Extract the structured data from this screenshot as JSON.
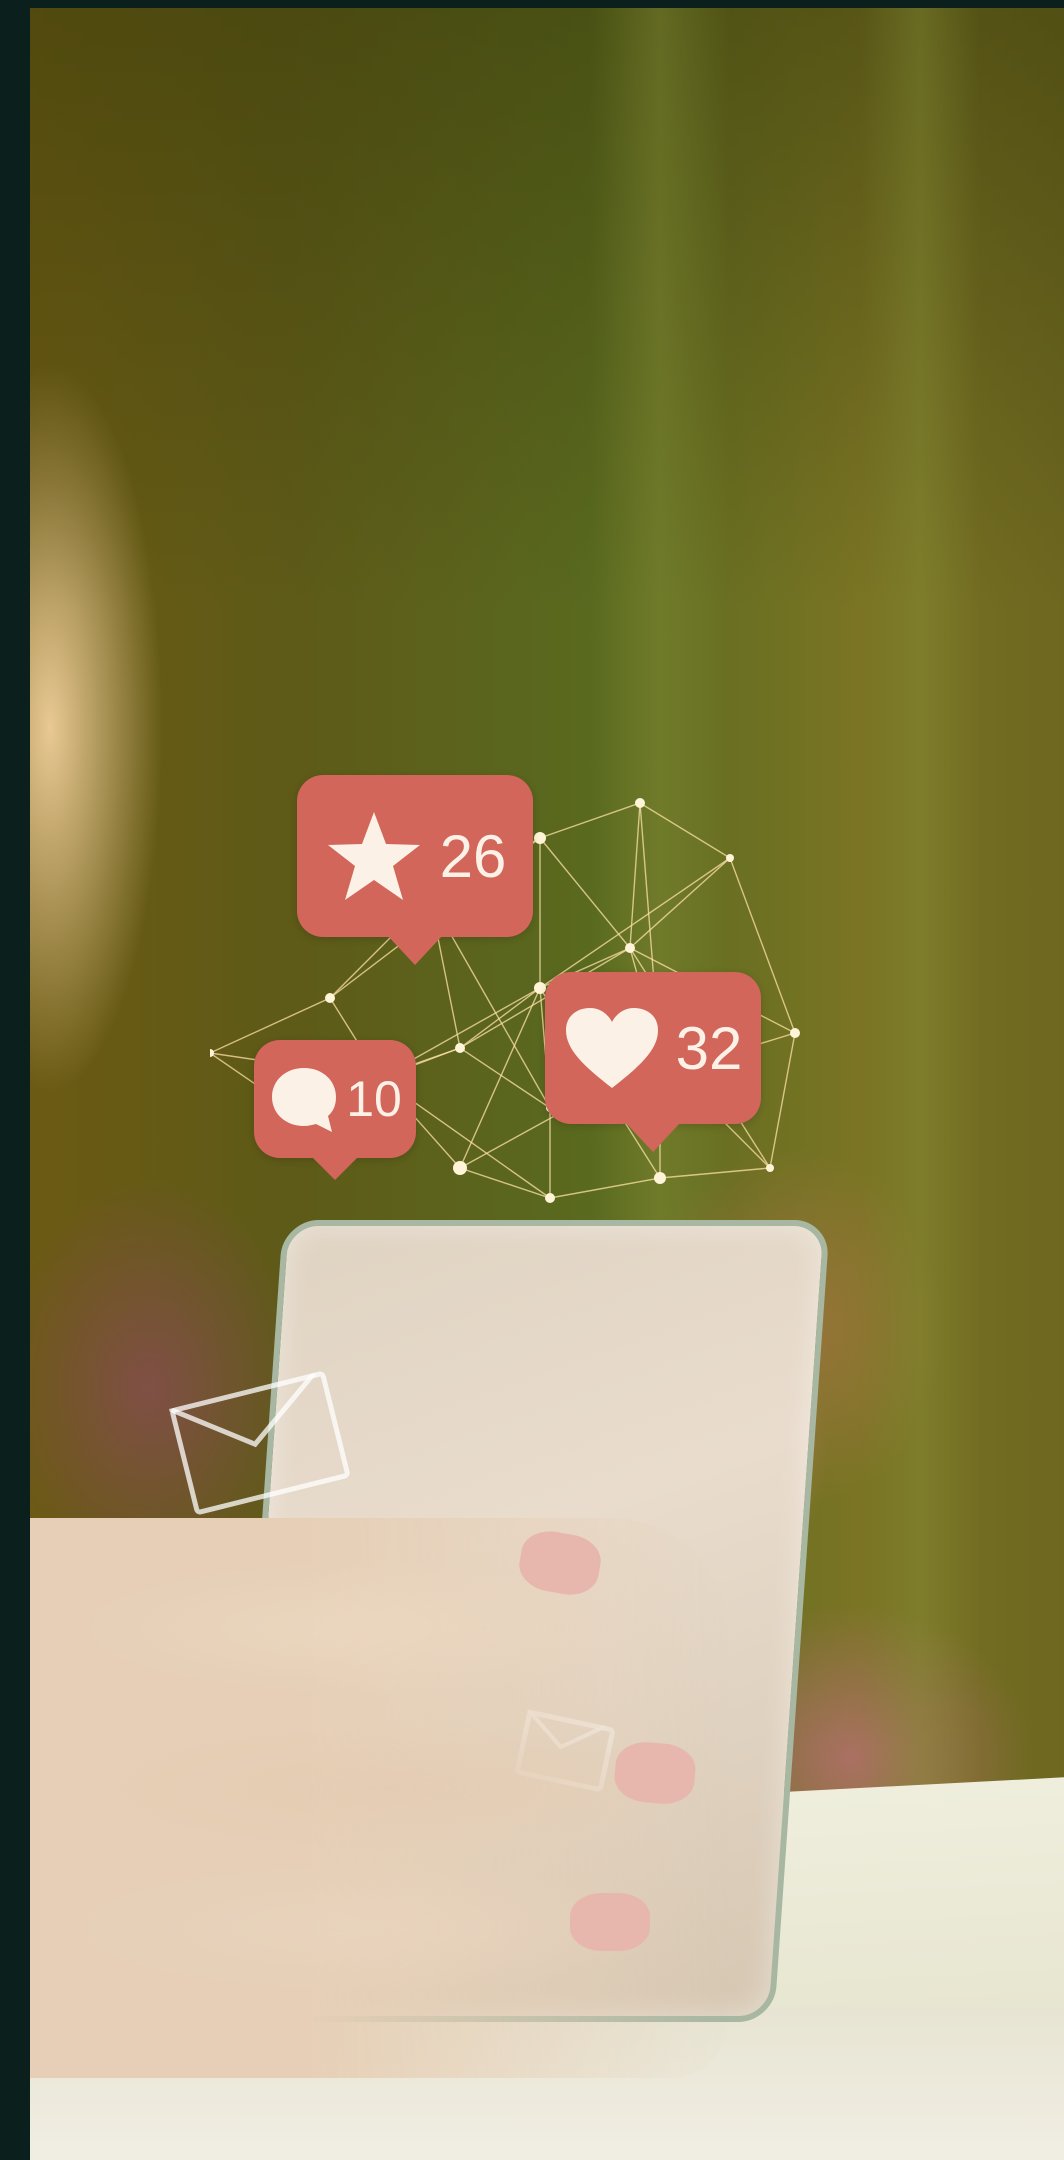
{
  "image": {
    "subject": "hand-holding-smartphone",
    "palette": {
      "frame": "#0b1f1c",
      "background": "#6b621b",
      "badge": "#d2665a",
      "badge_text": "#fbf1e6",
      "network_lines": "#ffe2a8"
    }
  },
  "notifications": {
    "star": {
      "icon": "star-icon",
      "count": "26"
    },
    "heart": {
      "icon": "heart-icon",
      "count": "32"
    },
    "comment": {
      "icon": "comment-icon",
      "count": "10"
    }
  }
}
